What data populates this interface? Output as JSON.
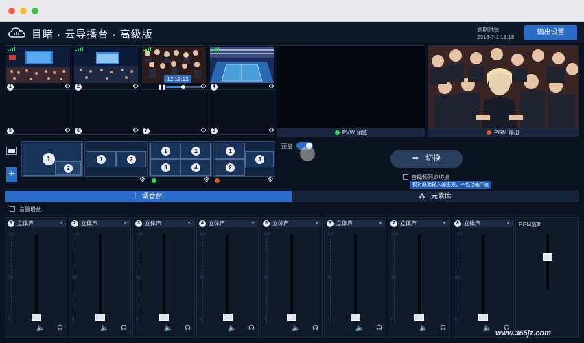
{
  "app": {
    "title": "目睹 · 云导播台 · 高级版",
    "expire_label": "到期时间",
    "expire_date": "2016-7-1 18:18",
    "output_settings": "输出设置"
  },
  "sources": [
    {
      "num": "1",
      "type": "conference"
    },
    {
      "num": "2",
      "type": "conference"
    },
    {
      "num": "3",
      "type": "crowd",
      "timecode": "12:12:12"
    },
    {
      "num": "4",
      "type": "tennis"
    },
    {
      "num": "5"
    },
    {
      "num": "6"
    },
    {
      "num": "7"
    },
    {
      "num": "8"
    }
  ],
  "preview": {
    "pvw_label": "PVW 预监",
    "pgm_label": "PGM 输出",
    "pvw_color": "#2ee05a",
    "pgm_color": "#e05a2e"
  },
  "layouts": {
    "pip": [
      "1",
      "2"
    ],
    "split2": [
      "1",
      "2"
    ],
    "quad": [
      "1",
      "2",
      "3",
      "4"
    ],
    "tri": [
      "1",
      "2",
      "3"
    ]
  },
  "controls": {
    "preview_toggle_label": "预监",
    "switch_label": "切换",
    "sync_label": "音视频同步切换",
    "sync_tip": "仅对原始输入源生效，不包括画中画"
  },
  "tabs": {
    "mixer": "调音台",
    "elements": "元素库"
  },
  "mixer": {
    "gain_label": "音量增益",
    "scale": [
      "100",
      "50",
      "0"
    ],
    "channels": [
      {
        "num": "1",
        "mode": "立体声"
      },
      {
        "num": "2",
        "mode": "立体声"
      },
      {
        "num": "3",
        "mode": "立体声"
      },
      {
        "num": "4",
        "mode": "立体声"
      },
      {
        "num": "5",
        "mode": "立体声"
      },
      {
        "num": "6",
        "mode": "立体声"
      },
      {
        "num": "7",
        "mode": "立体声"
      },
      {
        "num": "8",
        "mode": "立体声"
      }
    ],
    "pgm_monitor": "PGM监听"
  },
  "watermark": "www.365jz.com",
  "colors": {
    "accent": "#2a6cc8",
    "signal": "#2ee05a"
  }
}
